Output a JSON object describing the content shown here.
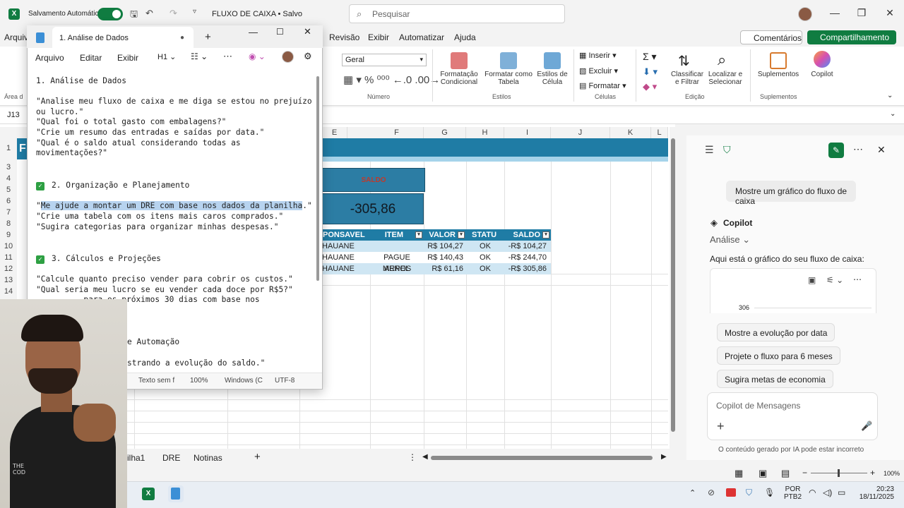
{
  "titlebar": {
    "autosave": "Salvamento Automático",
    "title": "FLUXO DE CAIXA • Salvo",
    "search_placeholder": "Pesquisar"
  },
  "menu": {
    "arquivo": "Arquiv",
    "revisao": "Revisão",
    "exibir": "Exibir",
    "automatizar": "Automatizar",
    "ajuda": "Ajuda",
    "comentarios": "Comentários",
    "compartilhamento": "Compartilhamento"
  },
  "ribbon": {
    "format_value": "Geral",
    "numero": "Número",
    "area": "Área d",
    "fmt_cond": "Formatação\nCondicional",
    "fmt_tabela": "Formatar como\nTabela",
    "estilos_celula": "Estilos de\nCélula",
    "estilos": "Estilos",
    "inserir": "Inserir",
    "excluir": "Excluir",
    "formatar": "Formatar",
    "celulas": "Células",
    "classificar": "Classificar\ne Filtrar",
    "localizar": "Localizar e\nSelecionar",
    "edicao": "Edição",
    "suplementos_btn": "Suplementos",
    "suplementos": "Suplementos",
    "copilot": "Copilot"
  },
  "namebox": "J13",
  "columns": [
    "E",
    "F",
    "G",
    "H",
    "I",
    "J",
    "K",
    "L"
  ],
  "rows": [
    "1",
    "2",
    "3",
    "4",
    "5",
    "6",
    "7",
    "8",
    "9",
    "10",
    "11",
    "12",
    "13",
    "14"
  ],
  "row1_text": "F",
  "saldo_label": "SALDO",
  "saldo_value": "-305,86",
  "table": {
    "headers": [
      "PONSAVEL",
      "ITEM",
      "VALOR",
      "STATU",
      "SALDO"
    ],
    "rows": [
      [
        "HAUANE",
        "",
        "R$ 104,27",
        "OK",
        "-R$ 104,27"
      ],
      [
        "HAUANE",
        "PAGUE MENOS",
        "R$ 140,43",
        "OK",
        "-R$ 244,70"
      ],
      [
        "HAUANE",
        "ARPEL",
        "R$ 61,16",
        "OK",
        "-R$ 305,86"
      ]
    ]
  },
  "sheet_tabs": [
    "ilha1",
    "DRE",
    "Notinas"
  ],
  "status": {
    "zoom": "100%"
  },
  "notepad": {
    "tab_title": "1. Análise de Dados",
    "menu": [
      "Arquivo",
      "Editar",
      "Exibir"
    ],
    "heading_sel": "H1",
    "lines": {
      "l1": "1. Análise de Dados",
      "l2": "\"Analise meu fluxo de caixa e me diga se estou no prejuízo",
      "l3": "ou lucro.\"",
      "l4": "\"Qual foi o total gasto com embalagens?\"",
      "l5": "\"Crie um resumo das entradas e saídas por data.\"",
      "l6": "\"Qual é o saldo atual considerando todas as",
      "l7": "movimentações?\"",
      "l8": "2. Organização e Planejamento",
      "l9_pre": "\"",
      "l9_hl": "Me ajude a montar um DRE com base nos dados da planilha",
      "l9_post": ".\"",
      "l10": "\"Crie uma tabela com os itens mais caros comprados.\"",
      "l11": "\"Sugira categorias para organizar minhas despesas.\"",
      "l12": "3. Cálculos e Projeções",
      "l13": "\"Calcule quanto preciso vender para cobrir os custos.\"",
      "l14": "\"Qual seria meu lucro se eu vender cada doce por R$5?\"",
      "l15": "          para os próximos 30 dias com base nos",
      "l16": "e Automação",
      "l17": "strando a evolução do saldo.\""
    },
    "status": {
      "s1": "Texto sem f",
      "s2": "100%",
      "s3": "Windows (C",
      "s4": "UTF-8"
    }
  },
  "copilot": {
    "user_msg": "Mostre um gráfico do fluxo de caixa",
    "name": "Copilot",
    "mode": "Análise",
    "reply": "Aqui está o gráfico do seu fluxo de caixa:",
    "chart_tick": "306",
    "chips": [
      "Mostre a evolução por data",
      "Projete o fluxo para 6 meses",
      "Sugira metas de economia"
    ],
    "input_placeholder": "Copilot de Mensagens",
    "disclaimer": "O conteúdo gerado por IA pode estar incorreto"
  },
  "taskbar": {
    "lang1": "POR",
    "lang2": "PTB2",
    "time": "20:23",
    "date": "18/11/2025"
  },
  "person_shirt": "THE\nCOD"
}
